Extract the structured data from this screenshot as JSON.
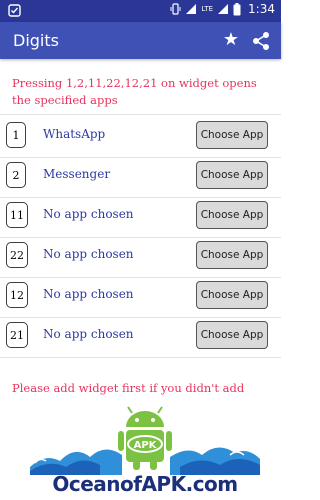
{
  "status_bar": {
    "network": "LTE",
    "time": "1:34"
  },
  "app_bar": {
    "title": "Digits",
    "icons": [
      "star-icon",
      "share-icon"
    ]
  },
  "intro_text": "Pressing 1,2,11,22,12,21 on widget opens the specified apps",
  "rows": [
    {
      "number": "1",
      "app": "WhatsApp",
      "button": "Choose App"
    },
    {
      "number": "2",
      "app": "Messenger",
      "button": "Choose App"
    },
    {
      "number": "11",
      "app": "No app chosen",
      "button": "Choose App"
    },
    {
      "number": "22",
      "app": "No app chosen",
      "button": "Choose App"
    },
    {
      "number": "12",
      "app": "No app chosen",
      "button": "Choose App"
    },
    {
      "number": "21",
      "app": "No app chosen",
      "button": "Choose App"
    }
  ],
  "footer_note": "Please add widget first if you didn't add",
  "watermark": {
    "logo_text": "APK",
    "brand_text": "OceanofAPK.com"
  },
  "colors": {
    "status_bar": "#2a3796",
    "app_bar": "#3f51b5",
    "accent_text": "#e8335c",
    "app_name": "#2c3aa0",
    "android_green": "#7cc242"
  }
}
